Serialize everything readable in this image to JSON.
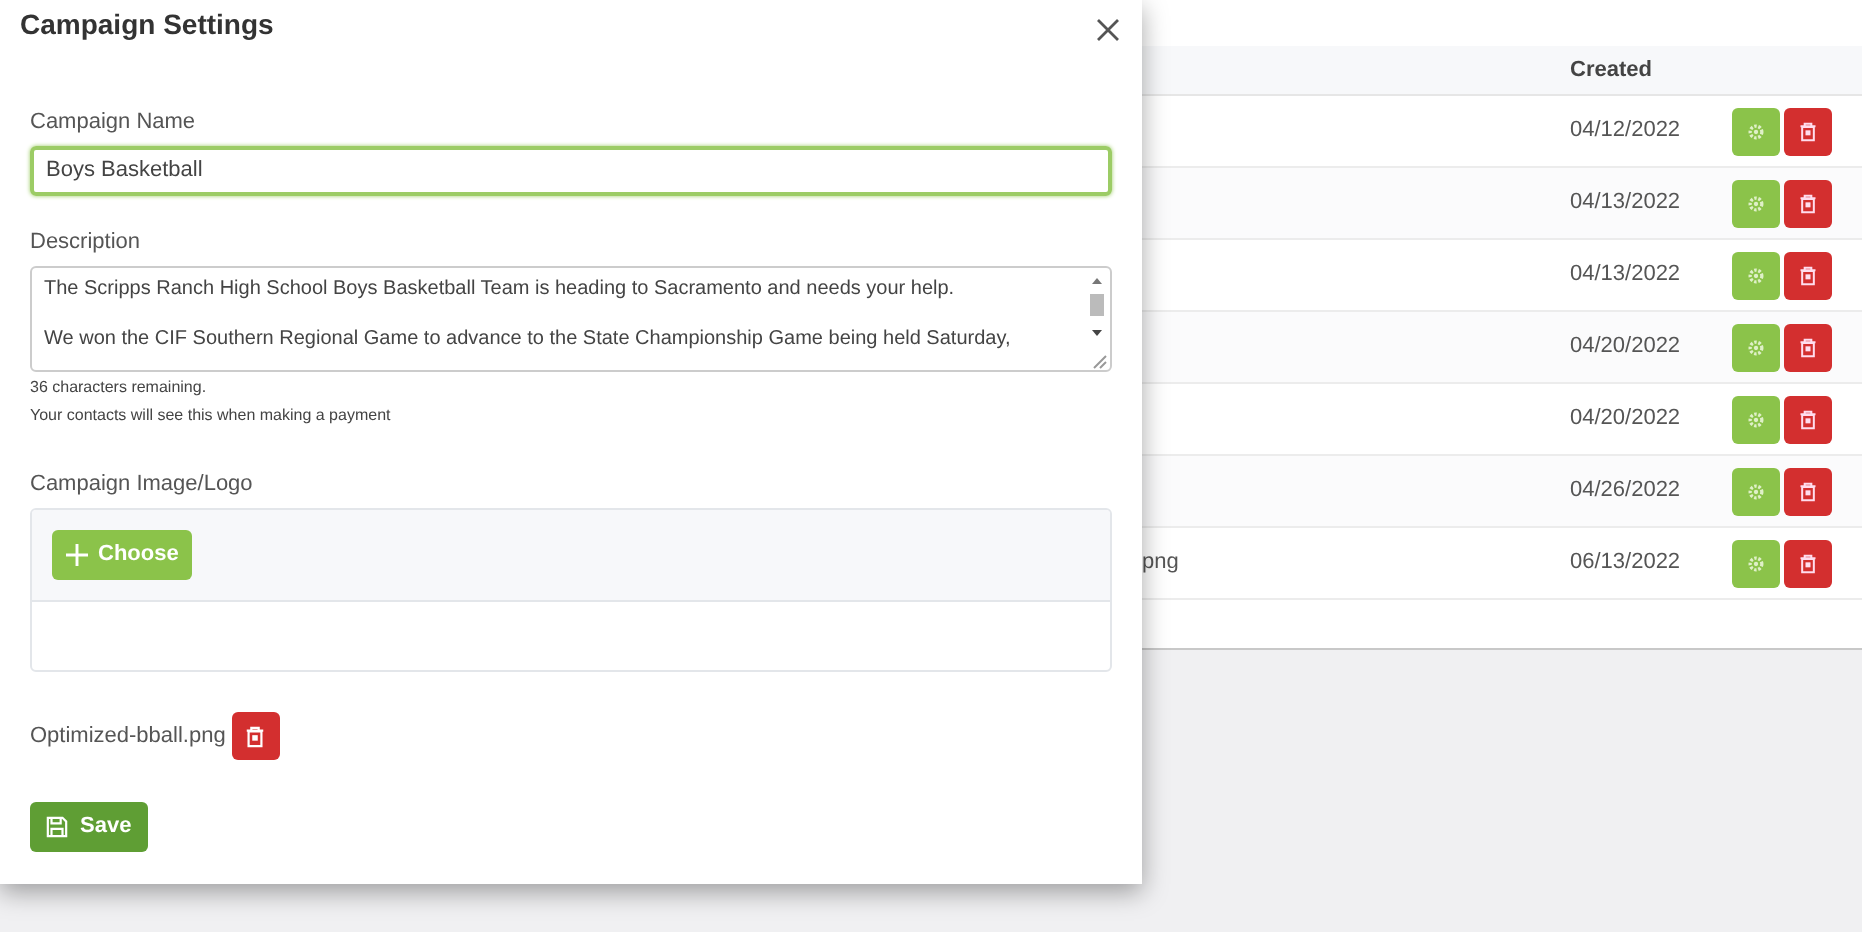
{
  "modal": {
    "title": "Campaign Settings",
    "name_field": {
      "label": "Campaign Name",
      "value": "Boys Basketball",
      "focused": true
    },
    "description_field": {
      "label": "Description",
      "paragraphs": [
        "The Scripps Ranch High School Boys Basketball Team is heading to Sacramento and needs your help.",
        "We won the CIF Southern Regional Game to advance to the State Championship Game being held Saturday,"
      ],
      "counter": "36 characters remaining.",
      "hint": "Your contacts will see this when making a payment"
    },
    "image_upload": {
      "label": "Campaign Image/Logo",
      "button": "Choose"
    },
    "file": {
      "name": "Optimized-bball.png"
    },
    "save_button": "Save"
  },
  "table": {
    "columns": [
      "Created"
    ],
    "rows": [
      {
        "column_1": "",
        "created": "04/12/2022"
      },
      {
        "column_1": "",
        "created": "04/13/2022"
      },
      {
        "column_1": "",
        "created": "04/13/2022"
      },
      {
        "column_1": "",
        "created": "04/20/2022"
      },
      {
        "column_1": "",
        "created": "04/20/2022"
      },
      {
        "column_1": "",
        "created": "04/26/2022"
      },
      {
        "column_1": "png",
        "created": "06/13/2022"
      }
    ]
  }
}
